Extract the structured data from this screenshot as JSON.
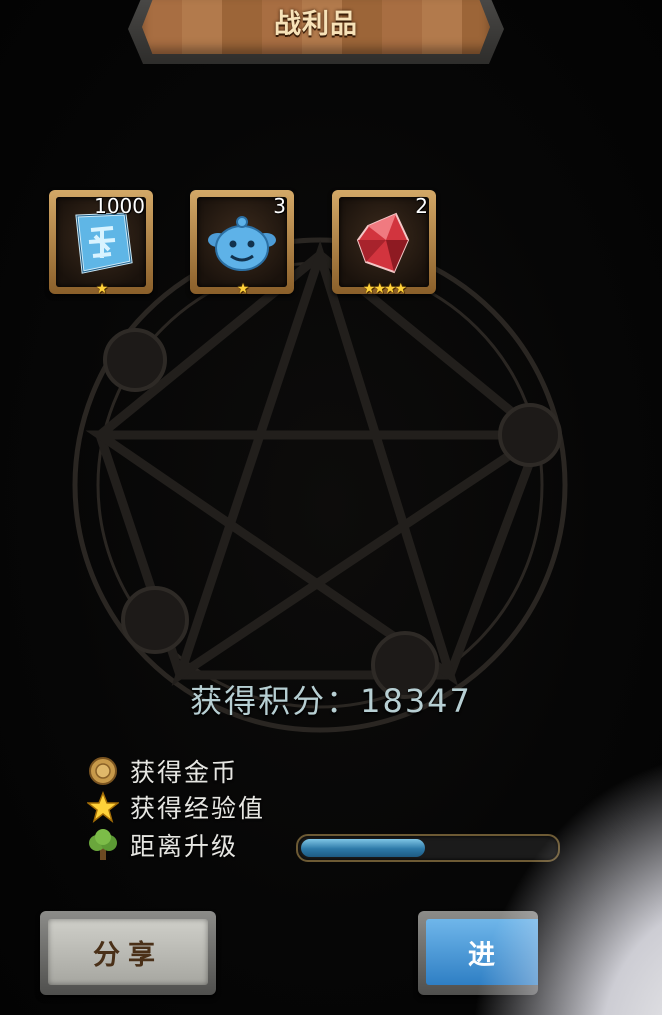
{
  "title": "战利品",
  "loot": [
    {
      "count": "1000",
      "stars": "★",
      "icon": "blue-rune-stone-icon"
    },
    {
      "count": "3",
      "stars": "★",
      "icon": "blue-slime-pet-icon"
    },
    {
      "count": "2",
      "stars": "★★★★",
      "icon": "red-crystal-icon"
    }
  ],
  "score": {
    "text": "获得积分：18347"
  },
  "rewards": {
    "gold_label": "获得金币",
    "exp_label": "获得经验值",
    "levelup_label": "距离升级",
    "level_progress": 0.49
  },
  "buttons": {
    "share_label": "分享",
    "continue_label": "进"
  },
  "colors": {
    "accent_blue": "#2f7fc4",
    "star_gold": "#ffd23a",
    "wood": "#a86e42"
  }
}
